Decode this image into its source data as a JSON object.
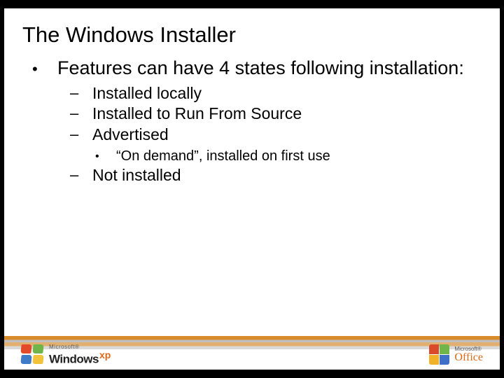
{
  "title": "The Windows Installer",
  "bullet1": "Features can have 4 states following installation:",
  "sub1": "Installed locally",
  "sub2": "Installed to Run From Source",
  "sub3": "Advertised",
  "sub3a": "“On demand”, installed on first use",
  "sub4": "Not installed",
  "footer": {
    "ms": "Microsoft®",
    "windows": "Windows",
    "xp": "xp",
    "office_ms": "Microsoft®",
    "office": "Office"
  }
}
